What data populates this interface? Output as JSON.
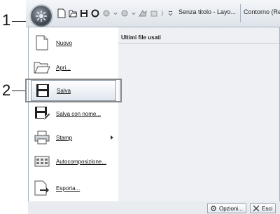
{
  "callouts": {
    "one": "1",
    "two": "2"
  },
  "toolbar": {
    "document_title": "Senza titolo - Layo...",
    "second_title": "Contorno (Re"
  },
  "menu": {
    "items": [
      {
        "label": "Nuovo",
        "icon": "new-document-icon"
      },
      {
        "label": "Apri...",
        "icon": "open-folder-icon"
      },
      {
        "label": "Salva",
        "icon": "save-icon"
      },
      {
        "label": "Salva con nome...",
        "icon": "save-as-icon"
      },
      {
        "label": "Stamp",
        "icon": "printer-icon"
      },
      {
        "label": "Autocomposizione...",
        "icon": "auto-layout-icon"
      },
      {
        "label": "Esporta...",
        "icon": "export-icon"
      }
    ],
    "recent_header": "Ultimi file usati"
  },
  "footer": {
    "options_label": "Opzioni...",
    "exit_label": "Esci"
  },
  "colors": {
    "accent": "#8a97a6",
    "panel": "#eef0f3"
  }
}
